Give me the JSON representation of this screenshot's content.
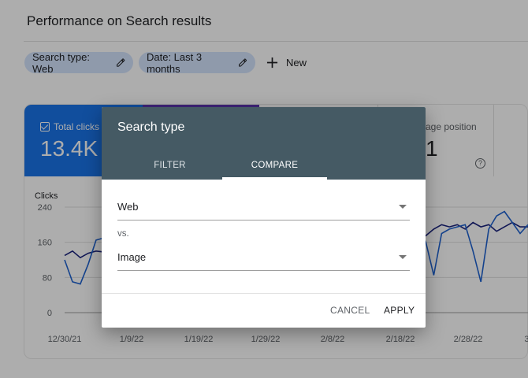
{
  "page": {
    "title": "Performance on Search results"
  },
  "filters": {
    "chips": [
      {
        "label": "Search type: Web",
        "icon": "pencil-icon"
      },
      {
        "label": "Date: Last 3 months",
        "icon": "pencil-icon"
      }
    ],
    "new_label": "New"
  },
  "metrics": {
    "clicks": {
      "label": "Total clicks",
      "value": "13.4K",
      "color": "#1a73e8"
    },
    "impressions_color": "#5e35b1",
    "position": {
      "label": "age position",
      "value": "1"
    }
  },
  "chart_data": {
    "type": "line",
    "ylabel": "Clicks",
    "y_ticks": [
      "240",
      "160",
      "80",
      "0"
    ],
    "ylim": [
      0,
      240
    ],
    "x_ticks": [
      "12/30/21",
      "1/9/22",
      "1/19/22",
      "1/29/22",
      "2/8/22",
      "2/18/22",
      "2/28/22",
      "3/"
    ],
    "grid": true,
    "series": [
      {
        "color": "#1a237e",
        "values": [
          130,
          140,
          125,
          135,
          140,
          138,
          145,
          150,
          150,
          155,
          160,
          158,
          160,
          160,
          165,
          165,
          170,
          170,
          165,
          168,
          170,
          175,
          172,
          175,
          178,
          180,
          175,
          170,
          180,
          185,
          190,
          195,
          200,
          205,
          195,
          210,
          190,
          205,
          185,
          200,
          180,
          170,
          185,
          190,
          195,
          185,
          175,
          190,
          200,
          195,
          200,
          190,
          205,
          195,
          200,
          185,
          195,
          205,
          195,
          195
        ]
      },
      {
        "color": "#1e62d0",
        "values": [
          120,
          70,
          65,
          110,
          165,
          170,
          145,
          160,
          150,
          148,
          152,
          155,
          150,
          160,
          158,
          150,
          162,
          155,
          160,
          165,
          160,
          170,
          168,
          165,
          170,
          172,
          165,
          180,
          175,
          170,
          178,
          180,
          175,
          185,
          170,
          200,
          185,
          205,
          190,
          210,
          150,
          80,
          170,
          185,
          190,
          200,
          160,
          85,
          180,
          190,
          195,
          200,
          140,
          70,
          190,
          220,
          230,
          205,
          180,
          200
        ]
      }
    ]
  },
  "dialog": {
    "title": "Search type",
    "tabs": [
      "FILTER",
      "COMPARE"
    ],
    "active_tab": "COMPARE",
    "first_value": "Web",
    "vs_label": "vs.",
    "second_value": "Image",
    "cancel_label": "CANCEL",
    "apply_label": "APPLY",
    "header_color": "#455a64"
  }
}
